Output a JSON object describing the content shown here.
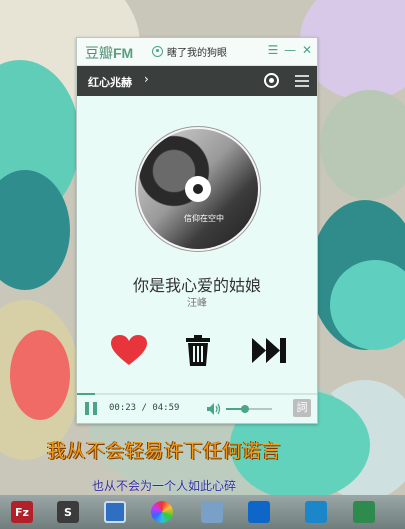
{
  "app": {
    "logo_cn": "豆瓣",
    "logo_fm": "FM",
    "username": "瞎了我的狗眼"
  },
  "window_controls": {
    "menu_icon": "list-icon",
    "minimize_icon": "minimize-icon",
    "close_icon": "close-icon"
  },
  "channel": {
    "name": "红心兆赫",
    "arrow": "›"
  },
  "now_playing": {
    "album_caption": "信仰在空中",
    "title": "你是我心爱的姑娘",
    "artist": "汪峰"
  },
  "controls": {
    "like_icon": "heart-icon",
    "trash_icon": "trash-icon",
    "skip_icon": "skip-icon"
  },
  "playback": {
    "time": "00:23 / 04:59",
    "progress_percent": 7.7,
    "volume_percent": 42,
    "lyrics_button_label": "詞"
  },
  "desktop_lyrics": {
    "line1": "我从不会轻易许下任何诺言",
    "line2": "也从不会为一个人如此心碎"
  },
  "taskbar": {
    "items": [
      {
        "name": "filezilla",
        "label": "Fz",
        "color": "#b2202a"
      },
      {
        "name": "sublime-text",
        "label": "S",
        "color": "#3b3b3b"
      },
      {
        "name": "window",
        "label": "",
        "color": "#2f6fc2"
      },
      {
        "name": "color-picker",
        "label": "",
        "color": "#ffffff"
      },
      {
        "name": "calculator",
        "label": "",
        "color": "#7aa0c8"
      },
      {
        "name": "teamviewer",
        "label": "",
        "color": "#0e67c8"
      },
      {
        "name": "douban-fm",
        "label": "",
        "color": "#4a4f4d"
      },
      {
        "name": "arch-linux",
        "label": "",
        "color": "#1b86c9"
      },
      {
        "name": "launcher",
        "label": "",
        "color": "#2f8a4e"
      }
    ]
  },
  "colors": {
    "accent": "#4aa587",
    "heart": "#e8353c",
    "lyric_primary": "#f39b19",
    "lyric_secondary": "#2e2a9e"
  }
}
